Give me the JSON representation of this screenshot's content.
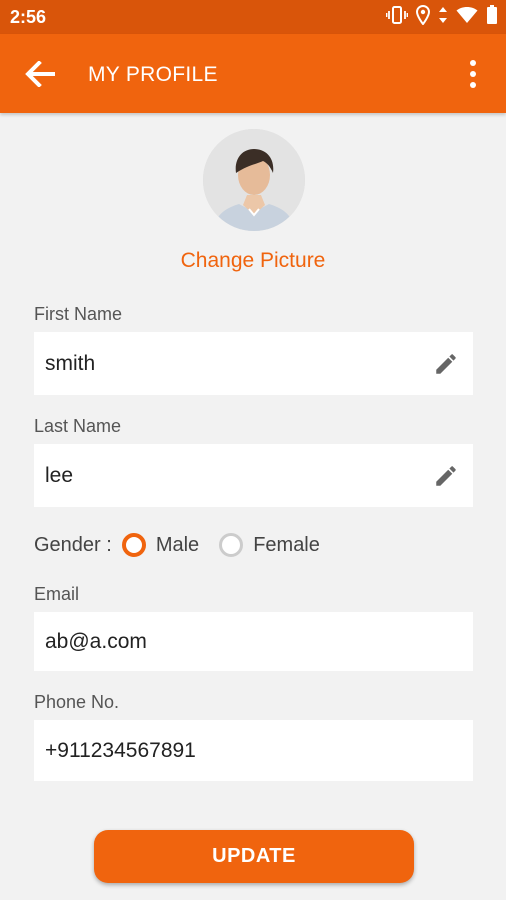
{
  "status_bar": {
    "time": "2:56",
    "icons": [
      "vibrate-icon",
      "location-icon",
      "data-arrows-icon",
      "wifi-icon",
      "battery-icon"
    ]
  },
  "app_bar": {
    "title": "MY PROFILE",
    "back_icon": "back-arrow-icon",
    "menu_icon": "more-vert-icon"
  },
  "profile": {
    "change_picture": "Change Picture"
  },
  "form": {
    "first_name": {
      "label": "First Name",
      "value": "smith"
    },
    "last_name": {
      "label": "Last Name",
      "value": "lee"
    },
    "gender": {
      "label": "Gender :",
      "options": [
        "Male",
        "Female"
      ],
      "selected": "Male"
    },
    "email": {
      "label": "Email",
      "value": "ab@a.com"
    },
    "phone": {
      "label": "Phone No.",
      "value": "+911234567891"
    }
  },
  "update_button": "UPDATE",
  "colors": {
    "primary": "#f0640e",
    "status_bar": "#d9550a",
    "background": "#f2f2f2"
  }
}
